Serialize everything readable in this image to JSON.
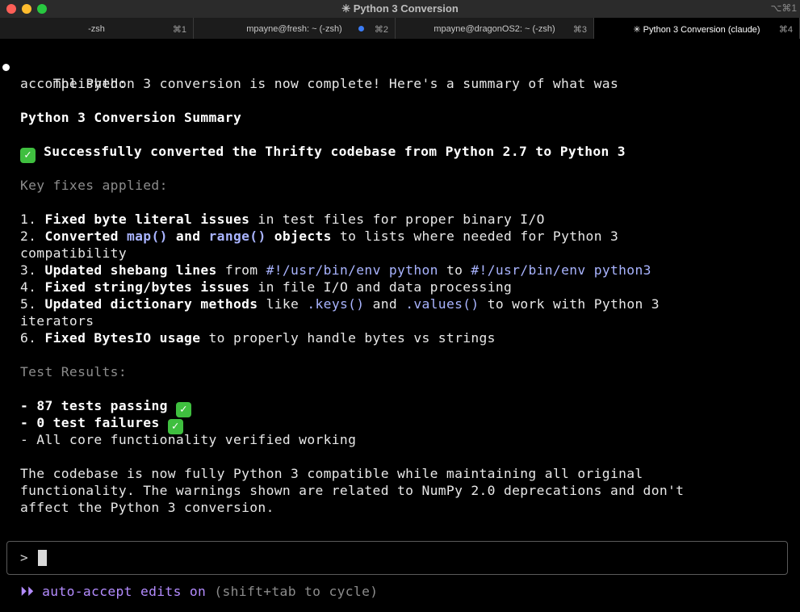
{
  "window": {
    "title": "✳ Python 3 Conversion",
    "corner_shortcut": "⌥⌘1"
  },
  "tabs": [
    {
      "label": "-zsh",
      "key": "⌘1"
    },
    {
      "label": "mpayne@fresh: ~ (-zsh)",
      "key": "⌘2"
    },
    {
      "label": "mpayne@dragonOS2: ~ (-zsh)",
      "key": "⌘3"
    },
    {
      "label": "✳ Python 3 Conversion (claude)",
      "key": "⌘4"
    }
  ],
  "content": {
    "intro_1": "The Python 3 conversion is now complete! Here's a summary of what was",
    "intro_2": "accomplished:",
    "heading": "Python 3 Conversion Summary",
    "success": "Successfully converted the Thrifty codebase from Python 2.7 to Python 3",
    "fixes_header": "Key fixes applied:",
    "fixes": {
      "f1_num": "1. ",
      "f1_bold": "Fixed byte literal issues",
      "f1_rest": " in test files for proper binary I/O",
      "f2_num": "2. ",
      "f2_bold_a": "Converted ",
      "f2_code_a": "map()",
      "f2_bold_b": " and ",
      "f2_code_b": "range()",
      "f2_bold_c": " objects",
      "f2_rest": " to lists where needed for Python 3",
      "f2_cont": "compatibility",
      "f3_num": "3. ",
      "f3_bold": "Updated shebang lines",
      "f3_a": " from ",
      "f3_code_a": "#!/usr/bin/env python",
      "f3_b": " to ",
      "f3_code_b": "#!/usr/bin/env python3",
      "f4_num": "4. ",
      "f4_bold": "Fixed string/bytes issues",
      "f4_rest": " in file I/O and data processing",
      "f5_num": "5. ",
      "f5_bold": "Updated dictionary methods",
      "f5_a": " like ",
      "f5_code_a": ".keys()",
      "f5_b": " and ",
      "f5_code_b": ".values()",
      "f5_c": " to work with Python 3",
      "f5_cont": "iterators",
      "f6_num": "6. ",
      "f6_bold": "Fixed BytesIO usage",
      "f6_rest": " to properly handle bytes vs strings"
    },
    "results_header": "Test Results:",
    "results": {
      "r1_dash": "- ",
      "r1_bold": "87 tests passing",
      "r2_dash": "- ",
      "r2_bold": "0 test failures",
      "r3": "- All core functionality verified working"
    },
    "closing_1": "The codebase is now fully Python 3 compatible while maintaining all original",
    "closing_2": "functionality. The warnings shown are related to NumPy 2.0 deprecations and don't",
    "closing_3": "affect the Python 3 conversion."
  },
  "input": {
    "prompt": ">",
    "value": ""
  },
  "footer": {
    "arrows": "⏵⏵",
    "mode": "auto-accept edits on",
    "hint": "(shift+tab to cycle)"
  },
  "colors": {
    "accent_code": "#a9b4ff",
    "mode_purple": "#b48cff",
    "check_green": "#3fbf3f"
  }
}
